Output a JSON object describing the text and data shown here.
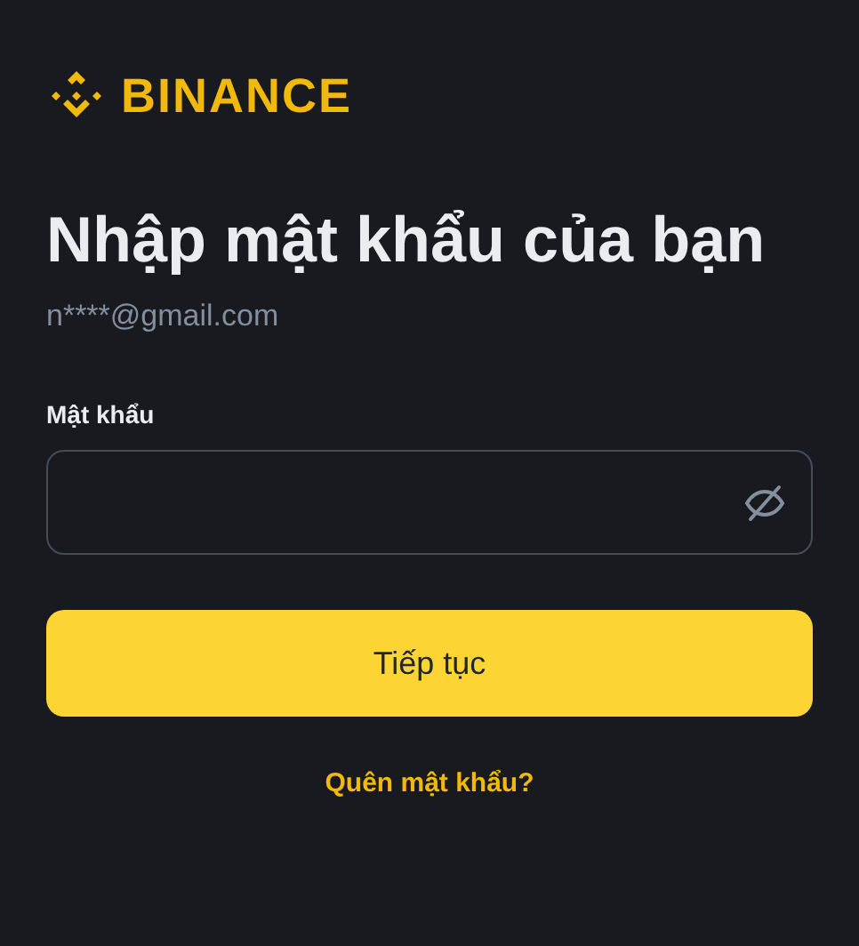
{
  "logo": {
    "text": "BINANCE"
  },
  "title": "Nhập mật khẩu của bạn",
  "email": "n****@gmail.com",
  "password_field": {
    "label": "Mật khẩu"
  },
  "submit_button": "Tiếp tục",
  "forgot_link": "Quên mật khẩu?"
}
